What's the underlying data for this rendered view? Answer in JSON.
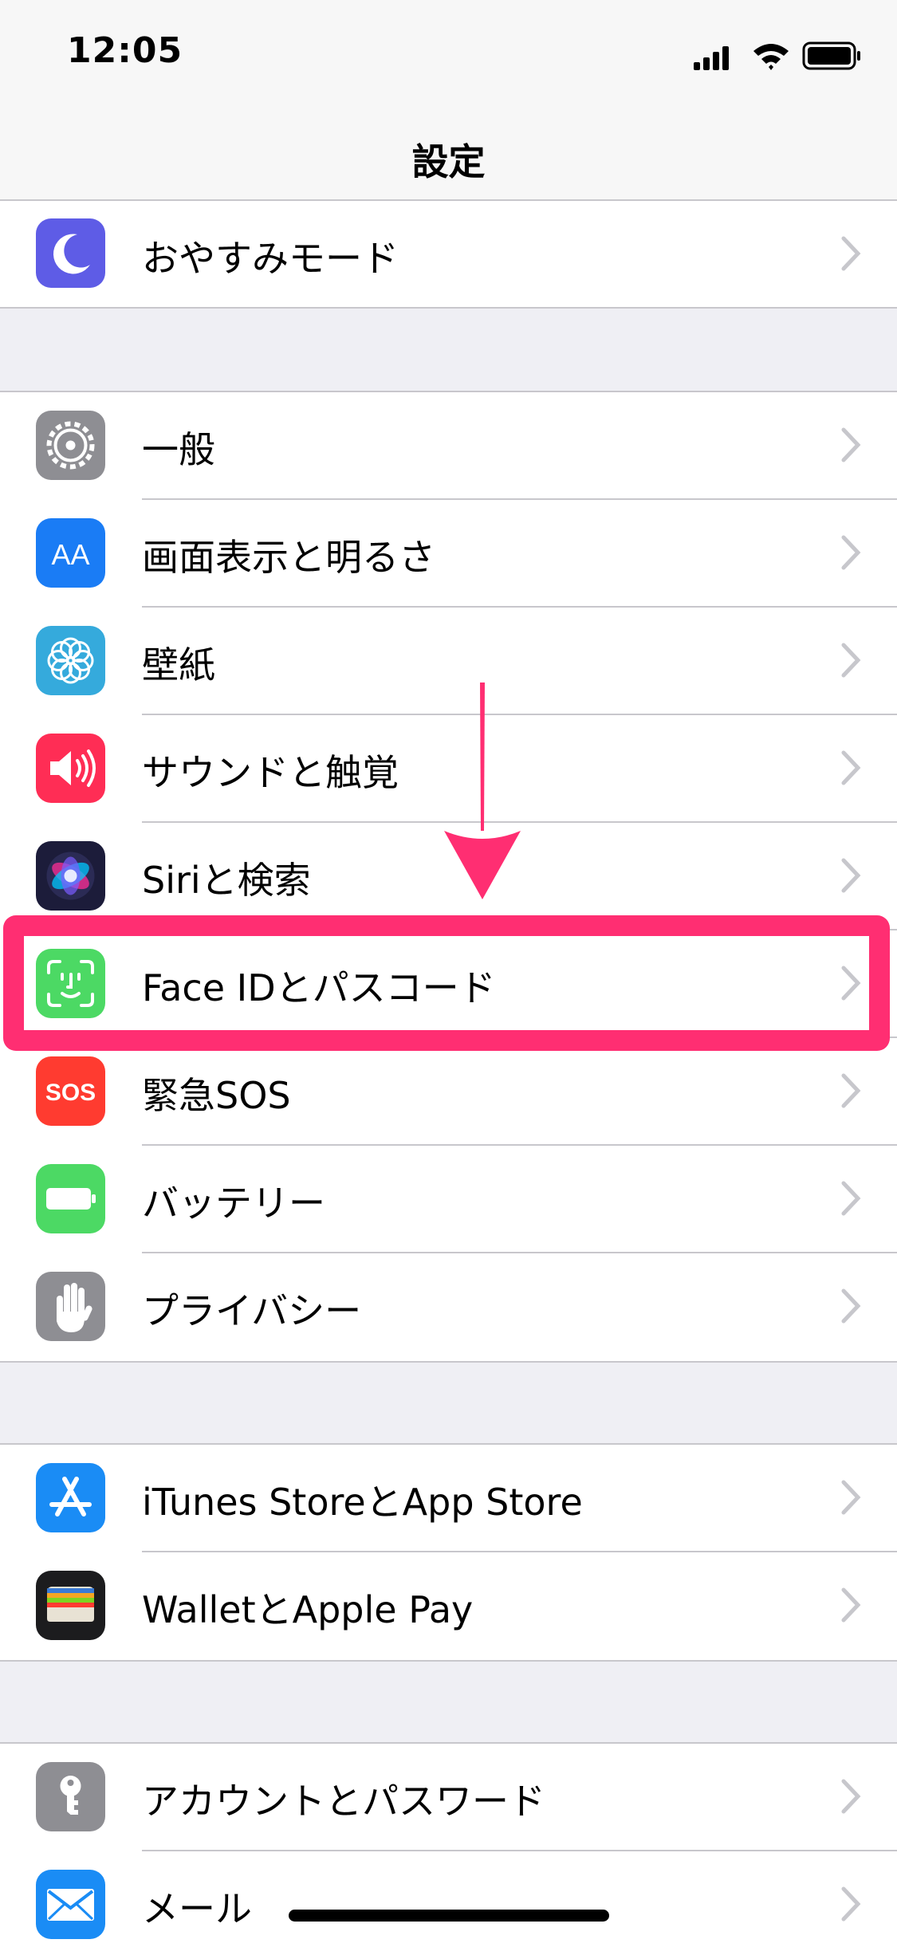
{
  "status": {
    "time": "12:05"
  },
  "nav": {
    "title": "設定"
  },
  "groups": [
    {
      "items": [
        {
          "label": "おやすみモード",
          "icon": "moon-icon",
          "color": "#5e5ce6"
        }
      ]
    },
    {
      "items": [
        {
          "label": "一般",
          "icon": "gear-icon",
          "color": "#8e8e93"
        },
        {
          "label": "画面表示と明るさ",
          "icon": "display-brightness-icon",
          "icon_text": "AA",
          "color": "#1a7cf5"
        },
        {
          "label": "壁紙",
          "icon": "wallpaper-flower-icon",
          "color": "#35aadc"
        },
        {
          "label": "サウンドと触覚",
          "icon": "speaker-icon",
          "color": "#ff2d55"
        },
        {
          "label": "Siriと検索",
          "icon": "siri-icon",
          "color": "#1c1c3a"
        },
        {
          "label": "Face IDとパスコード",
          "icon": "face-id-icon",
          "color": "#4cd964",
          "highlighted": true
        },
        {
          "label": "緊急SOS",
          "icon": "sos-icon",
          "icon_text": "SOS",
          "color": "#ff3b30"
        },
        {
          "label": "バッテリー",
          "icon": "battery-icon",
          "color": "#4cd964"
        },
        {
          "label": "プライバシー",
          "icon": "hand-icon",
          "color": "#8e8e93"
        }
      ]
    },
    {
      "items": [
        {
          "label": "iTunes StoreとApp Store",
          "icon": "app-store-icon",
          "color": "#1a8cf5"
        },
        {
          "label": "WalletとApple Pay",
          "icon": "wallet-icon",
          "color": "#1c1c1e"
        }
      ]
    },
    {
      "items": [
        {
          "label": "アカウントとパスワード",
          "icon": "key-icon",
          "color": "#8e8e93"
        },
        {
          "label": "メール",
          "icon": "mail-icon",
          "color": "#1a8cf5"
        }
      ]
    }
  ],
  "annotations": {
    "highlight_color": "#ff2e72",
    "arrow": "arrow-down-icon"
  }
}
